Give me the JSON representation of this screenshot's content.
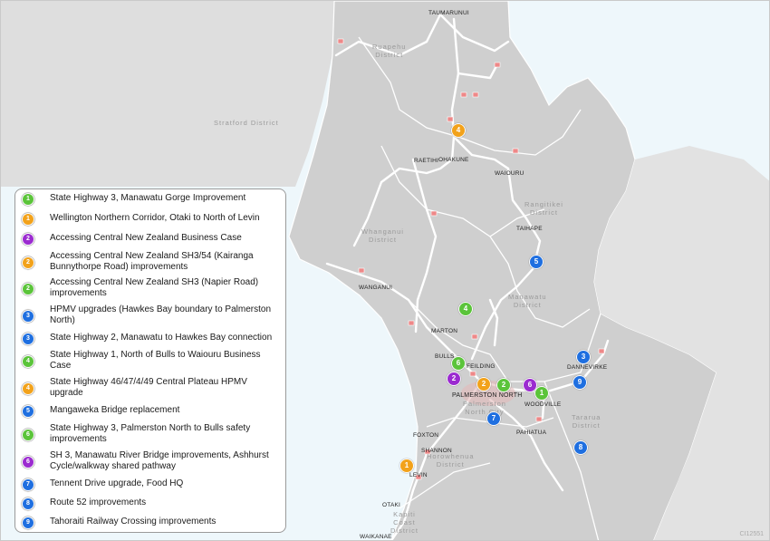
{
  "colors": {
    "green": "#5bc43a",
    "orange": "#f2a21b",
    "purple": "#9b2bd0",
    "blue": "#1f6fe0",
    "sea": "#eef7fb",
    "land": "#dcdcdc"
  },
  "places": {
    "taumarunui": "TAUMARUNUI",
    "raetihi": "RAETIHI",
    "ohakune": "OHAKUNE",
    "waiouru": "WAIOURU",
    "taihape": "TAIHAPE",
    "wanganui": "WANGANUI",
    "marton": "MARTON",
    "bulls": "BULLS",
    "feilding": "FEILDING",
    "palmerston_north": "PALMERSTON NORTH",
    "woodville": "WOODVILLE",
    "dannevirke": "DANNEVIRKE",
    "pahiatua": "PAHIATUA",
    "foxton": "FOXTON",
    "shannon": "SHANNON",
    "levin": "LEVIN",
    "otaki": "OTAKI",
    "waikanae": "WAIKANAE"
  },
  "districts": {
    "ruapehu": "Ruapehu\nDistrict",
    "stratford": "Stratford District",
    "rangitikei": "Rangitikei\nDistrict",
    "whanganui": "Whanganui\nDistrict",
    "manawatu": "Manawatu\nDistrict",
    "tararua": "Tararua\nDistrict",
    "palmerston_north_city": "Palmerston\nNorth City",
    "horowhenua": "Horowhenua\nDistrict",
    "kapiti_coast": "Kapiti\nCoast\nDistrict"
  },
  "markers": [
    {
      "num": "4",
      "color": "orange"
    },
    {
      "num": "5",
      "color": "blue"
    },
    {
      "num": "4",
      "color": "green"
    },
    {
      "num": "6",
      "color": "green"
    },
    {
      "num": "2",
      "color": "purple"
    },
    {
      "num": "2",
      "color": "orange"
    },
    {
      "num": "2",
      "color": "green"
    },
    {
      "num": "6",
      "color": "purple"
    },
    {
      "num": "1",
      "color": "green"
    },
    {
      "num": "3",
      "color": "blue"
    },
    {
      "num": "9",
      "color": "blue"
    },
    {
      "num": "7",
      "color": "blue"
    },
    {
      "num": "8",
      "color": "blue"
    },
    {
      "num": "1",
      "color": "orange"
    }
  ],
  "legend": [
    {
      "num": "1",
      "color": "green",
      "label": "State Highway 3, Manawatu Gorge Improvement"
    },
    {
      "num": "1",
      "color": "orange",
      "label": "Wellington Northern Corridor, Otaki to North of Levin"
    },
    {
      "num": "2",
      "color": "purple",
      "label": "Accessing Central New Zealand Business Case"
    },
    {
      "num": "2",
      "color": "orange",
      "label": "Accessing Central New Zealand SH3/54 (Kairanga Bunnythorpe Road) improvements"
    },
    {
      "num": "2",
      "color": "green",
      "label": "Accessing Central New Zealand SH3 (Napier Road) improvements"
    },
    {
      "num": "3",
      "color": "blue",
      "label": "HPMV upgrades (Hawkes Bay boundary to Palmerston North)"
    },
    {
      "num": "3",
      "color": "blue",
      "label": "State Highway 2, Manawatu to Hawkes Bay connection"
    },
    {
      "num": "4",
      "color": "green",
      "label": "State Highway 1, North of Bulls to Waiouru Business Case"
    },
    {
      "num": "4",
      "color": "orange",
      "label": "State Highway 46/47/4/49 Central Plateau HPMV upgrade"
    },
    {
      "num": "5",
      "color": "blue",
      "label": "Mangaweka Bridge replacement"
    },
    {
      "num": "6",
      "color": "green",
      "label": "State Highway 3, Palmerston North to Bulls safety improvements"
    },
    {
      "num": "6",
      "color": "purple",
      "label": "SH 3, Manawatu River Bridge improvements,  Ashhurst Cycle/walkway shared pathway"
    },
    {
      "num": "7",
      "color": "blue",
      "label": "Tennent Drive upgrade, Food HQ"
    },
    {
      "num": "8",
      "color": "blue",
      "label": "Route 52 improvements"
    },
    {
      "num": "9",
      "color": "blue",
      "label": "Tahoraiti Railway Crossing improvements"
    }
  ],
  "ref_code": "CI12551"
}
